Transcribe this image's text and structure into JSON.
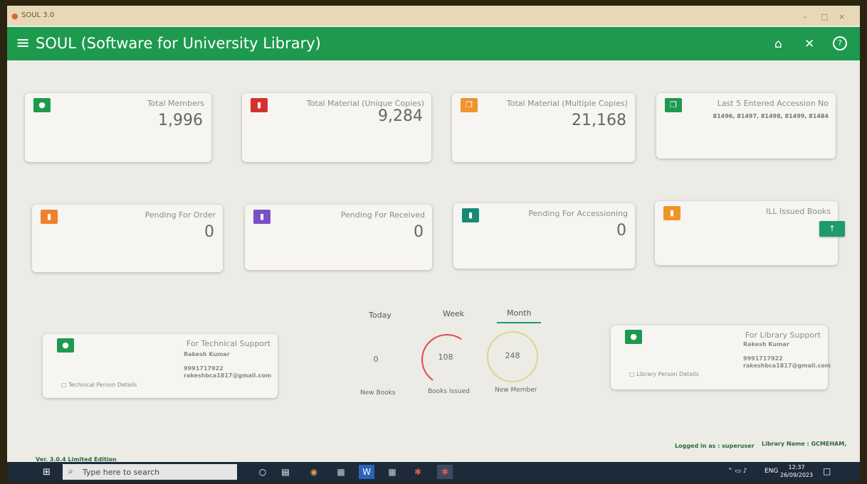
{
  "window": {
    "title": "SOUL 3.0",
    "minimize": "–",
    "maximize": "□",
    "close": "×"
  },
  "header": {
    "menu_glyph": "≡",
    "title": "SOUL (Software for University Library)",
    "home_glyph": "⌂",
    "close_glyph": "✕",
    "help_glyph": "?"
  },
  "cards": [
    {
      "label": "Total Members",
      "value": "1,996",
      "icon": "person-icon",
      "color": "#1d9a4e"
    },
    {
      "label": "Total Material (Unique Copies)",
      "value": "9,284",
      "icon": "book-icon",
      "color": "#d3322f"
    },
    {
      "label": "Total Material (Multiple Copies)",
      "value": "21,168",
      "icon": "copies-icon",
      "color": "#f0932b"
    },
    {
      "label": "Last 5 Entered Accession No",
      "value": "81496, 81497, 81498, 81499, 81484",
      "icon": "copies-icon",
      "color": "#1d9a4e"
    },
    {
      "label": "Pending For Order",
      "value": "0",
      "icon": "bookmark-icon",
      "color": "#f0802b"
    },
    {
      "label": "Pending For Received",
      "value": "0",
      "icon": "bookmark-icon",
      "color": "#7b4fc4"
    },
    {
      "label": "Pending For Accessioning",
      "value": "0",
      "icon": "bookmark-icon",
      "color": "#168a76"
    },
    {
      "label": "ILL Issued Books",
      "value": "",
      "icon": "bookmark-icon",
      "color": "#f0932b"
    }
  ],
  "up_button": "↑",
  "tabs": [
    "Today",
    "Week",
    "Month"
  ],
  "stats": [
    {
      "value": "0",
      "caption": "New Books"
    },
    {
      "value": "108",
      "caption": "Books Issued"
    },
    {
      "value": "248",
      "caption": "New Member"
    }
  ],
  "tech_support": {
    "title": "For Technical Support",
    "name": "Rakesh Kumar",
    "phone": "9991717922",
    "email": "rakeshbca1817@gmail.com",
    "details": "□ Technical Person Details"
  },
  "lib_support": {
    "title": "For Library Support",
    "name": "Rakesh Kumar",
    "phone": "9991717922",
    "email": "rakeshbca1817@gmail.com",
    "details": "□ Library Person Details"
  },
  "status": {
    "version": "Ver. 3.0.4  Limited Edition",
    "logged_in": "Logged in as : superuser",
    "library_name": "Library Name : GCMEHAM,"
  },
  "taskbar": {
    "start": "⊞",
    "search_icon": "⌕",
    "search_placeholder": "Type here to search",
    "tray_text": "ENG",
    "time": "12:37",
    "date": "26/09/2023"
  }
}
